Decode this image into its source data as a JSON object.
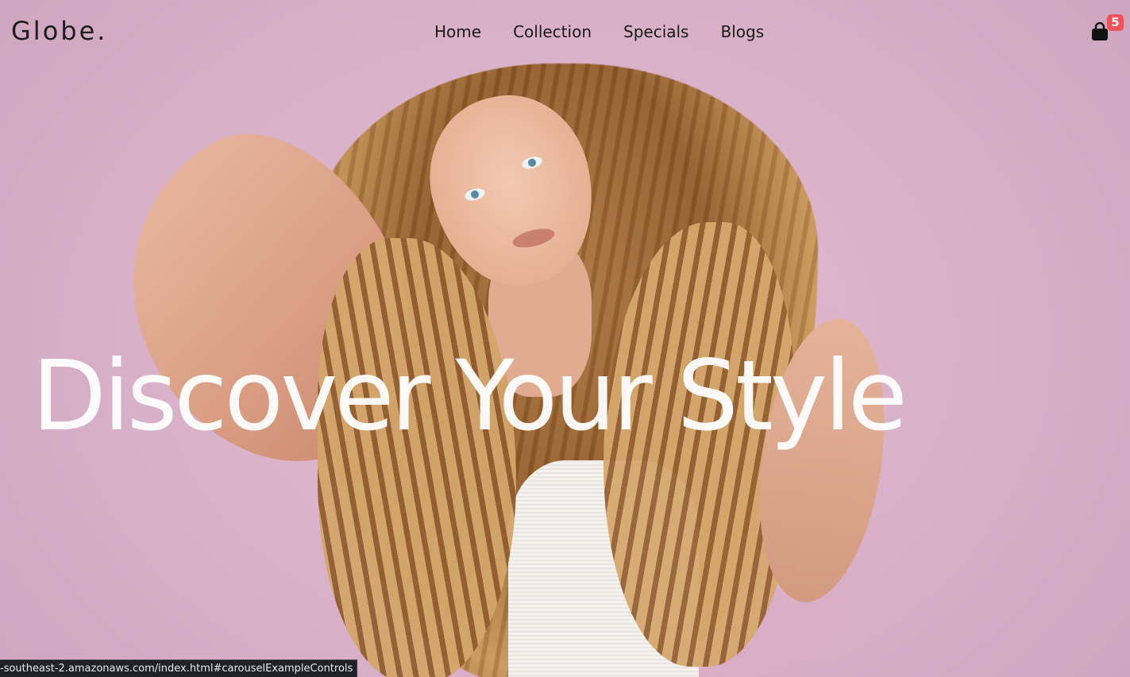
{
  "brand": {
    "name": "Globe."
  },
  "nav": {
    "links": [
      {
        "label": "Home"
      },
      {
        "label": "Collection"
      },
      {
        "label": "Specials"
      },
      {
        "label": "Blogs"
      }
    ]
  },
  "cart": {
    "icon": "shopping-bag-icon",
    "count": "5",
    "badge_color": "#f0535a"
  },
  "hero": {
    "title": "Discover Your Style",
    "background_color": "#d9b3c9"
  },
  "status_bar": {
    "url": "-southeast-2.amazonaws.com/index.html#carouselExampleControls"
  }
}
